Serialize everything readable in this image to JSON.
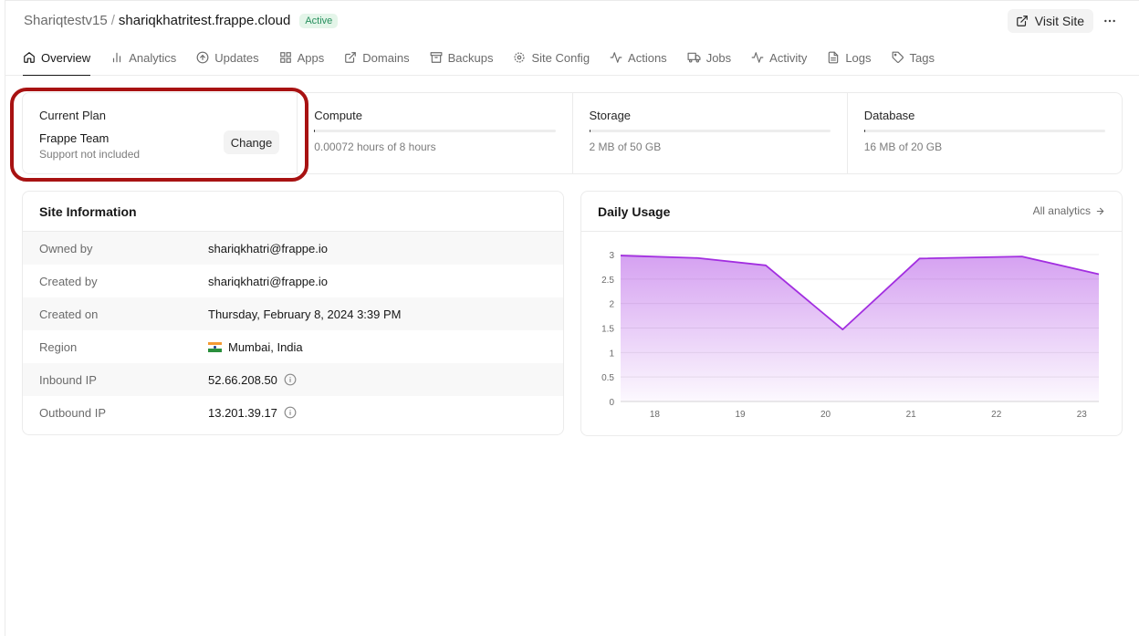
{
  "breadcrumb": {
    "parent": "Shariqtestv15",
    "separator": "/",
    "current": "shariqkhatritest.frappe.cloud",
    "status": "Active"
  },
  "header": {
    "visit_label": "Visit Site"
  },
  "tabs": [
    {
      "label": "Overview",
      "icon": "home-icon"
    },
    {
      "label": "Analytics",
      "icon": "bar-chart-icon"
    },
    {
      "label": "Updates",
      "icon": "arrow-up-circle-icon"
    },
    {
      "label": "Apps",
      "icon": "grid-icon"
    },
    {
      "label": "Domains",
      "icon": "external-link-icon"
    },
    {
      "label": "Backups",
      "icon": "archive-icon"
    },
    {
      "label": "Site Config",
      "icon": "settings-icon"
    },
    {
      "label": "Actions",
      "icon": "activity-icon"
    },
    {
      "label": "Jobs",
      "icon": "truck-icon"
    },
    {
      "label": "Activity",
      "icon": "activity-icon"
    },
    {
      "label": "Logs",
      "icon": "file-text-icon"
    },
    {
      "label": "Tags",
      "icon": "tag-icon"
    }
  ],
  "plan": {
    "title": "Current Plan",
    "name": "Frappe Team",
    "support": "Support not included",
    "change_label": "Change",
    "compute": {
      "title": "Compute",
      "text": "0.00072 hours of 8 hours",
      "fraction": 9e-05
    },
    "storage": {
      "title": "Storage",
      "text": "2 MB of 50 GB",
      "fraction": 4e-05
    },
    "database": {
      "title": "Database",
      "text": "16 MB of 20 GB",
      "fraction": 0.0008
    }
  },
  "site_info": {
    "title": "Site Information",
    "rows": [
      {
        "label": "Owned by",
        "value": "shariqkhatri@frappe.io"
      },
      {
        "label": "Created by",
        "value": "shariqkhatri@frappe.io"
      },
      {
        "label": "Created on",
        "value": "Thursday, February 8, 2024 3:39 PM"
      },
      {
        "label": "Region",
        "value": "Mumbai, India"
      },
      {
        "label": "Inbound IP",
        "value": "52.66.208.50"
      },
      {
        "label": "Outbound IP",
        "value": "13.201.39.17"
      }
    ]
  },
  "usage": {
    "title": "Daily Usage",
    "link_label": "All analytics"
  },
  "colors": {
    "accent": "#a22ee0",
    "badge_bg": "#e4f5e9",
    "badge_text": "#278f5e",
    "highlight": "#a81212"
  },
  "chart_data": {
    "type": "area",
    "x": [
      17.6,
      18.5,
      19.3,
      20.2,
      21.1,
      22.3,
      23.2
    ],
    "xticks": [
      "18",
      "19",
      "20",
      "21",
      "22",
      "23"
    ],
    "xtick_values": [
      18,
      19,
      20,
      21,
      22,
      23
    ],
    "values": [
      2.98,
      2.93,
      2.78,
      1.47,
      2.92,
      2.96,
      2.6
    ],
    "yticks": [
      "0",
      "0.5",
      "1",
      "1.5",
      "2",
      "2.5",
      "3"
    ],
    "ylim": [
      0,
      3
    ],
    "xlim": [
      17.6,
      23.2
    ],
    "grid": true
  }
}
